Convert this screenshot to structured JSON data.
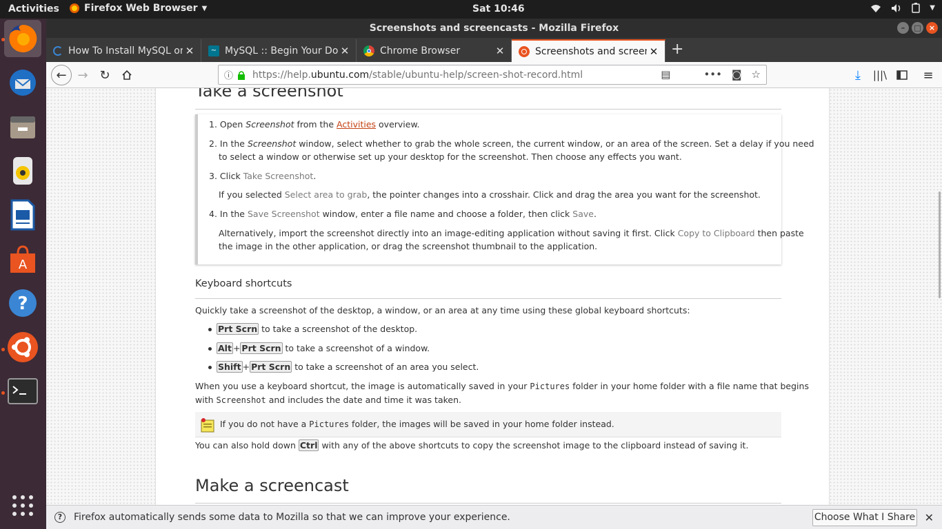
{
  "topbar": {
    "activities": "Activities",
    "app_name": "Firefox Web Browser",
    "clock": "Sat 10:46"
  },
  "window": {
    "title": "Screenshots and screencasts - Mozilla Firefox"
  },
  "tabs": [
    {
      "label": "How To Install MySQL on",
      "active": false
    },
    {
      "label": "MySQL :: Begin Your Dow",
      "active": false
    },
    {
      "label": "Chrome Browser",
      "active": false
    },
    {
      "label": "Screenshots and screenc",
      "active": true
    }
  ],
  "navbar": {
    "url_prefix": "https://help.",
    "url_domain": "ubuntu.com",
    "url_path": "/stable/ubuntu-help/screen-shot-record.html"
  },
  "content": {
    "heading_screenshot": "Take a screenshot",
    "steps": {
      "s1_a": "1. Open ",
      "s1_b": "Screenshot",
      "s1_c": " from the ",
      "s1_link": "Activities",
      "s1_d": " overview.",
      "s2_a": "2. In the ",
      "s2_b": "Screenshot",
      "s2_c": " window, select whether to grab the whole screen, the current window, or an area of the screen. Set a delay if you need",
      "s2_line2": "to select a window or otherwise set up your desktop for the screenshot. Then choose any effects you want.",
      "s3_a": "3. Click ",
      "s3_gui": "Take Screenshot",
      "s3_b": ".",
      "s3p_a": "If you selected ",
      "s3p_gui": "Select area to grab",
      "s3p_b": ", the pointer changes into a crosshair. Click and drag the area you want for the screenshot.",
      "s4_a": "4. In the ",
      "s4_gui": "Save Screenshot",
      "s4_b": " window, enter a file name and choose a folder, then click ",
      "s4_gui2": "Save",
      "s4_c": ".",
      "s4p_a": "Alternatively, import the screenshot directly into an image-editing application without saving it first. Click ",
      "s4p_gui": "Copy to Clipboard",
      "s4p_b": " then paste",
      "s4p_line2": "the image in the other application, or drag the screenshot thumbnail to the application."
    },
    "keyboard_heading": "Keyboard shortcuts",
    "kb_intro": "Quickly take a screenshot of the desktop, a window, or an area at any time using these global keyboard shortcuts:",
    "shortcuts": {
      "k1_key": "Prt Scrn",
      "k1_text": " to take a screenshot of the desktop.",
      "k2_key1": "Alt",
      "k2_plus": "+",
      "k2_key2": "Prt Scrn",
      "k2_text": " to take a screenshot of a window.",
      "k3_key1": "Shift",
      "k3_plus": "+",
      "k3_key2": "Prt Scrn",
      "k3_text": " to take a screenshot of an area you select."
    },
    "para1_a": "When you use a keyboard shortcut, the image is automatically saved in your ",
    "para1_mono": "Pictures",
    "para1_b": " folder in your home folder with a file name that begins",
    "para1_c": "with ",
    "para1_mono2": "Screenshot",
    "para1_d": " and includes the date and time it was taken.",
    "note_a": "If you do not have a ",
    "note_mono": "Pictures",
    "note_b": " folder, the images will be saved in your home folder instead.",
    "para2_a": "You can also hold down ",
    "para2_key": "Ctrl",
    "para2_b": " with any of the above shortcuts to copy the screenshot image to the clipboard instead of saving it.",
    "heading_screencast": "Make a screencast"
  },
  "notification": {
    "message": "Firefox automatically sends some data to Mozilla so that we can improve your experience.",
    "button": "Choose What I Share"
  },
  "colors": {
    "ubuntu_orange": "#e95420",
    "link": "#c34113",
    "dock_bg": "#3c2a36"
  }
}
